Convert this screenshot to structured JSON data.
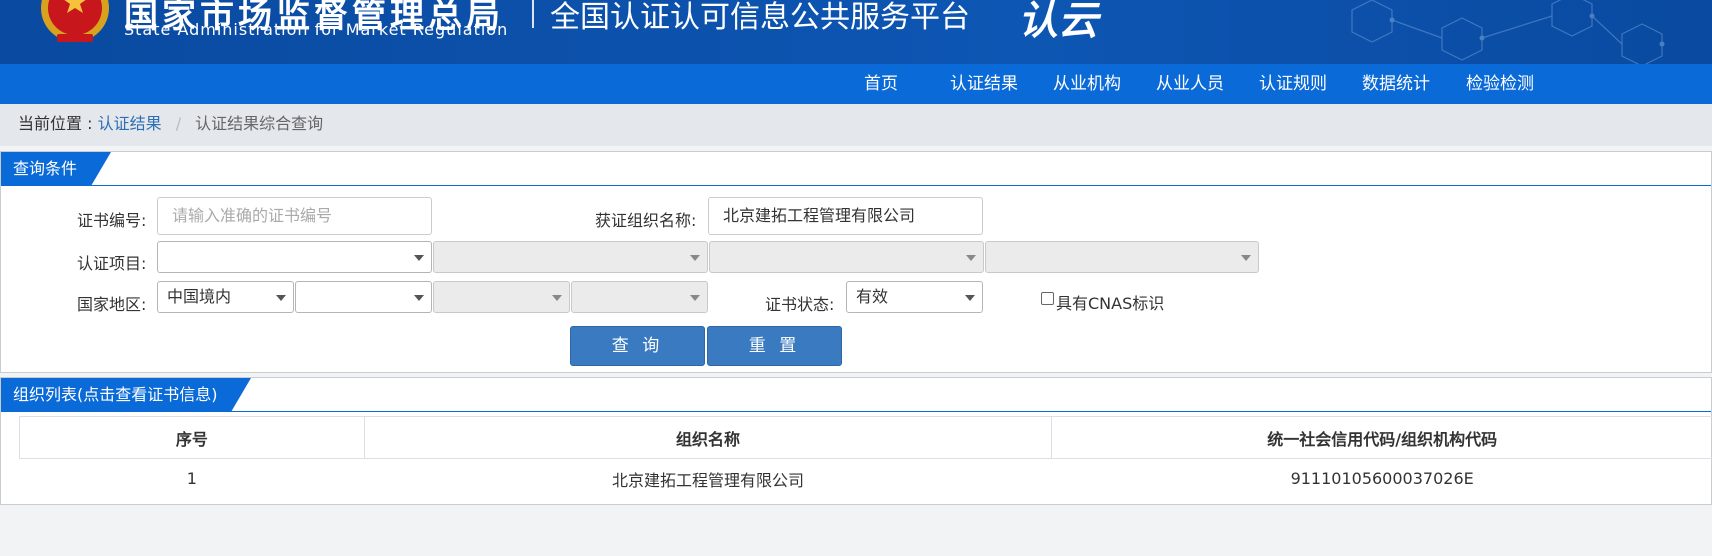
{
  "header": {
    "agency_cn": "国家市场监督管理总局",
    "agency_en": "State Administration for Market Regulation",
    "platform_title": "全国认证认可信息公共服务平台",
    "logo_text": "认云",
    "banner_color": "#0b4fa8"
  },
  "nav": {
    "items": [
      "首页",
      "认证结果",
      "从业机构",
      "从业人员",
      "认证规则",
      "数据统计",
      "检验检测"
    ],
    "bar_color": "#0a6ad8"
  },
  "breadcrumb": {
    "prefix": "当前位置 :",
    "link": "认证结果",
    "separator": "/",
    "current": "认证结果综合查询"
  },
  "query_panel": {
    "title": "查询条件",
    "cert_no_label": "证书编号:",
    "cert_no_placeholder": "请输入准确的证书编号",
    "org_name_label": "获证组织名称:",
    "org_name_value": "北京建拓工程管理有限公司",
    "project_label": "认证项目:",
    "project_selects": [
      "",
      "",
      "",
      ""
    ],
    "region_label": "国家地区:",
    "region_selects": [
      "中国境内",
      "",
      "",
      ""
    ],
    "status_label": "证书状态:",
    "status_value": "有效",
    "cnas_label": "具有CNAS标识",
    "cnas_checked": false,
    "search_button": "查 询",
    "reset_button": "重 置",
    "button_color": "#3a7ac0"
  },
  "list_panel": {
    "title": "组织列表(点击查看证书信息)",
    "columns": [
      "序号",
      "组织名称",
      "统一社会信用代码/组织机构代码"
    ],
    "rows": [
      {
        "index": "1",
        "name": "北京建拓工程管理有限公司",
        "code": "91110105600037026E"
      }
    ]
  }
}
